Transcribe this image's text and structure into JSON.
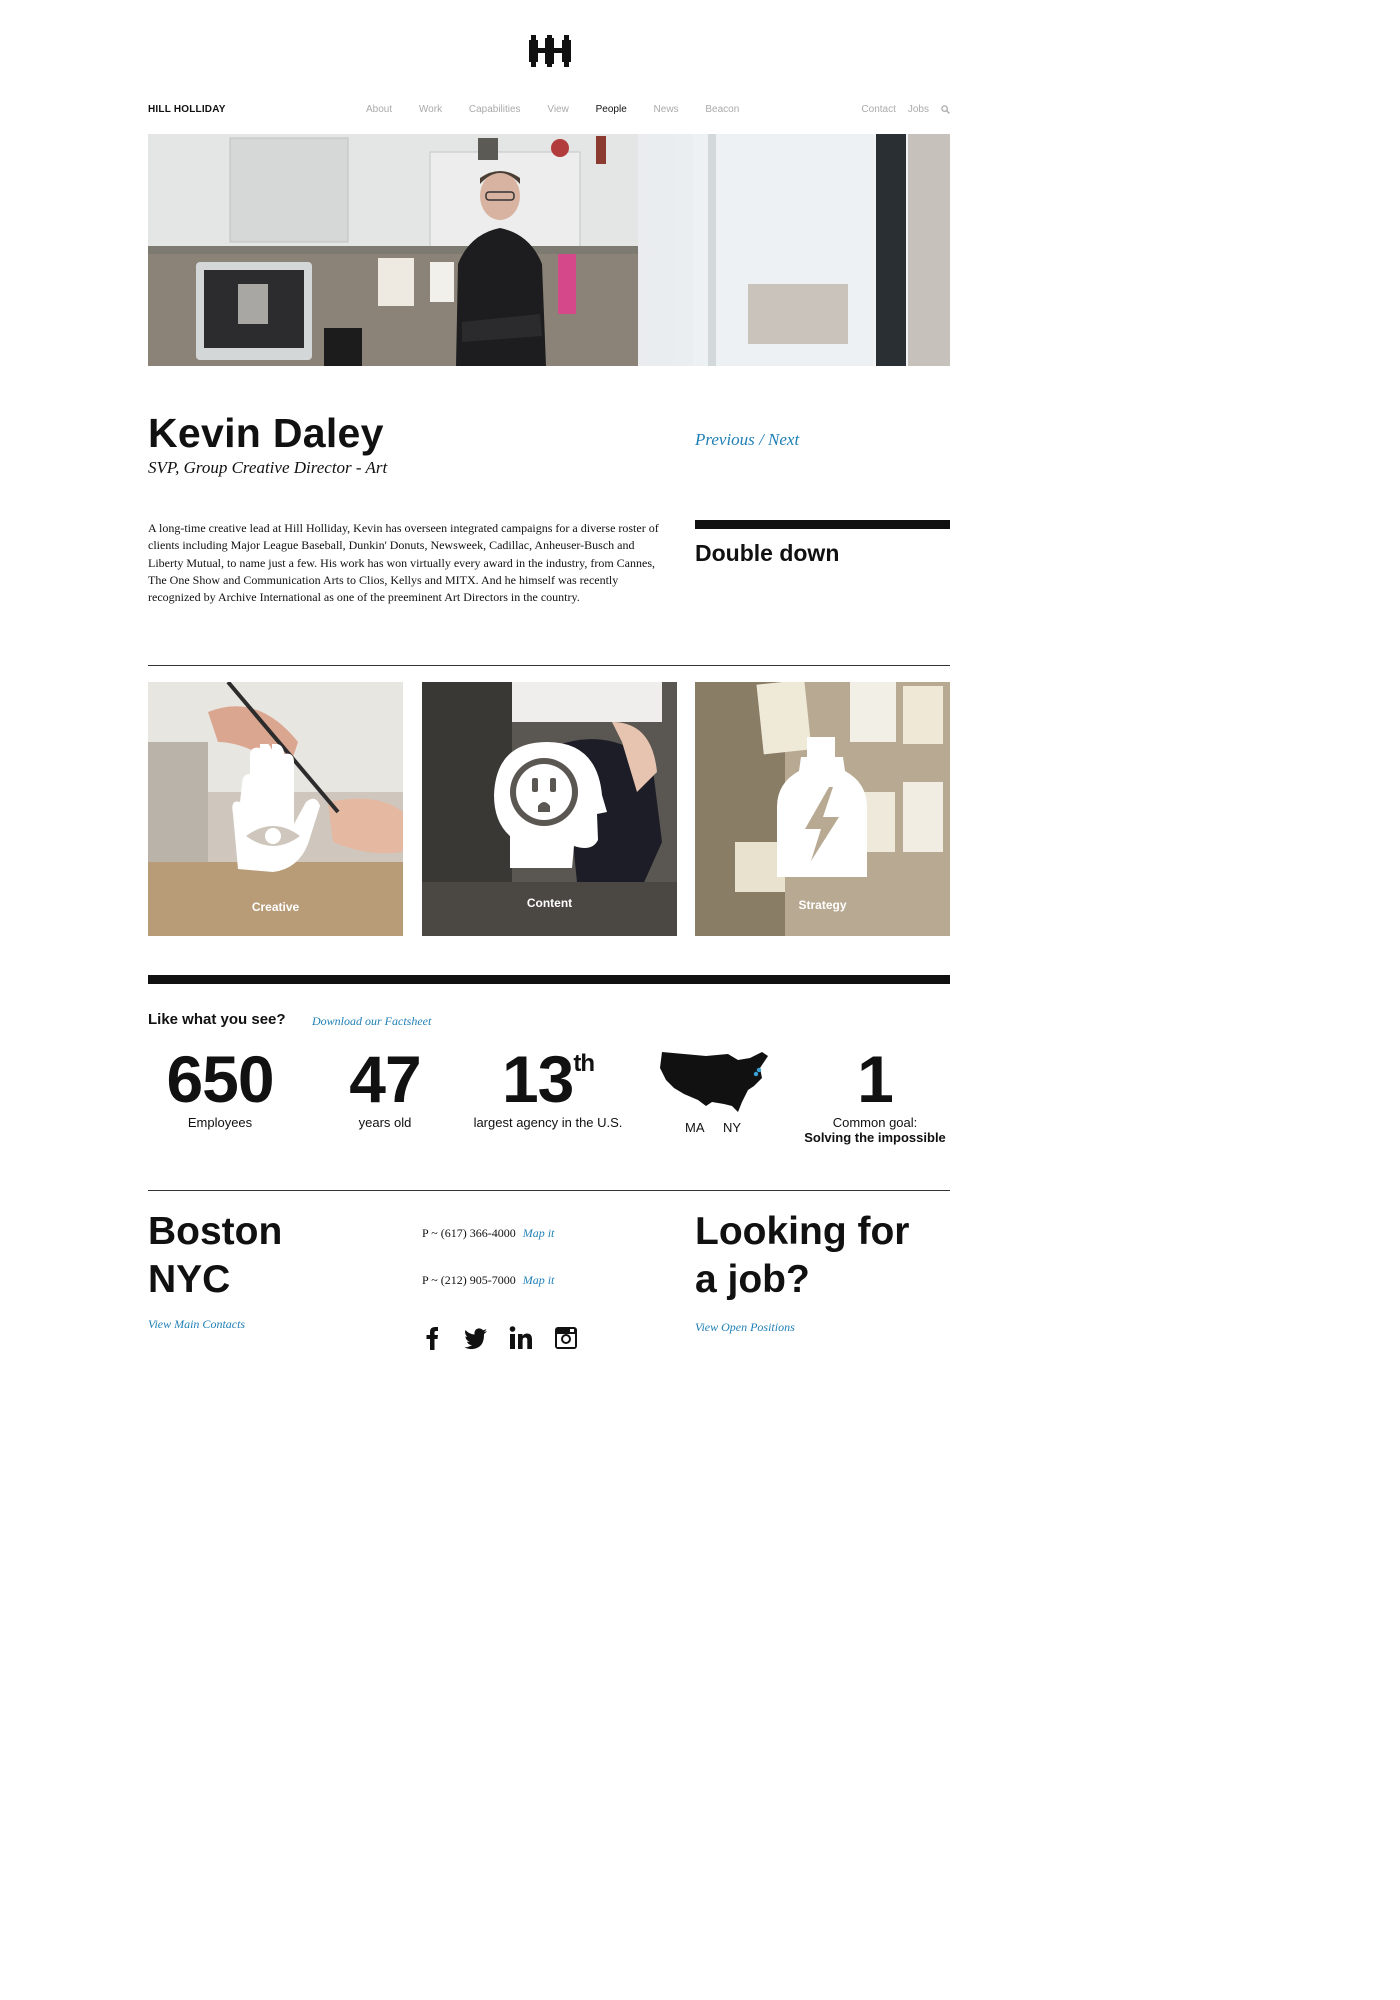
{
  "header": {
    "brand": "HILL HOLLIDAY",
    "nav": [
      "About",
      "Work",
      "Capabilities",
      "View",
      "People",
      "News",
      "Beacon"
    ],
    "nav_right": [
      "Contact",
      "Jobs"
    ]
  },
  "profile": {
    "name": "Kevin Daley",
    "title": "SVP, Group Creative Director - Art",
    "bio": "A long-time creative lead at Hill Holliday, Kevin has overseen integrated campaigns for a diverse roster of clients including Major League Baseball, Dunkin' Donuts, Newsweek, Cadillac, Anheuser-Busch and Liberty Mutual, to name just a few. His work has won virtually every award in the industry, from Cannes, The One Show and Communication Arts to Clios, Kellys and MITX. And he himself was recently recognized by Archive International as one of the preeminent Art Directors in the country.",
    "previous": "Previous",
    "separator": "/",
    "next": "Next",
    "feature_title": "Double down"
  },
  "capabilities": [
    {
      "label": "Creative",
      "icon": "hand-eye-icon"
    },
    {
      "label": "Content",
      "icon": "head-outlet-icon"
    },
    {
      "label": "Strategy",
      "icon": "bottle-lightning-icon"
    }
  ],
  "facts": {
    "heading": "Like what you see?",
    "factsheet_link": "Download our Factsheet",
    "stats": [
      {
        "number": "650",
        "label": "Employees"
      },
      {
        "number": "47",
        "label": "years old"
      },
      {
        "number": "13",
        "sup": "th",
        "label": "largest agency in the U.S."
      },
      {
        "label_left": "MA",
        "label_right": "NY"
      },
      {
        "number": "1",
        "label": "Common goal:",
        "label_bold": "Solving the impossible"
      }
    ]
  },
  "footer": {
    "cities": [
      "Boston",
      "NYC"
    ],
    "main_contacts": "View Main Contacts",
    "phones": [
      {
        "number": "P ~ (617) 366-4000",
        "map": "Map it"
      },
      {
        "number": "P ~ (212) 905-7000",
        "map": "Map it"
      }
    ],
    "social": [
      "facebook-icon",
      "twitter-icon",
      "linkedin-icon",
      "instagram-icon"
    ],
    "jobs_line1": "Looking for",
    "jobs_line2": "a job?",
    "open_positions": "View Open Positions"
  },
  "colors": {
    "accent": "#1f7fb5",
    "text": "#111111"
  }
}
